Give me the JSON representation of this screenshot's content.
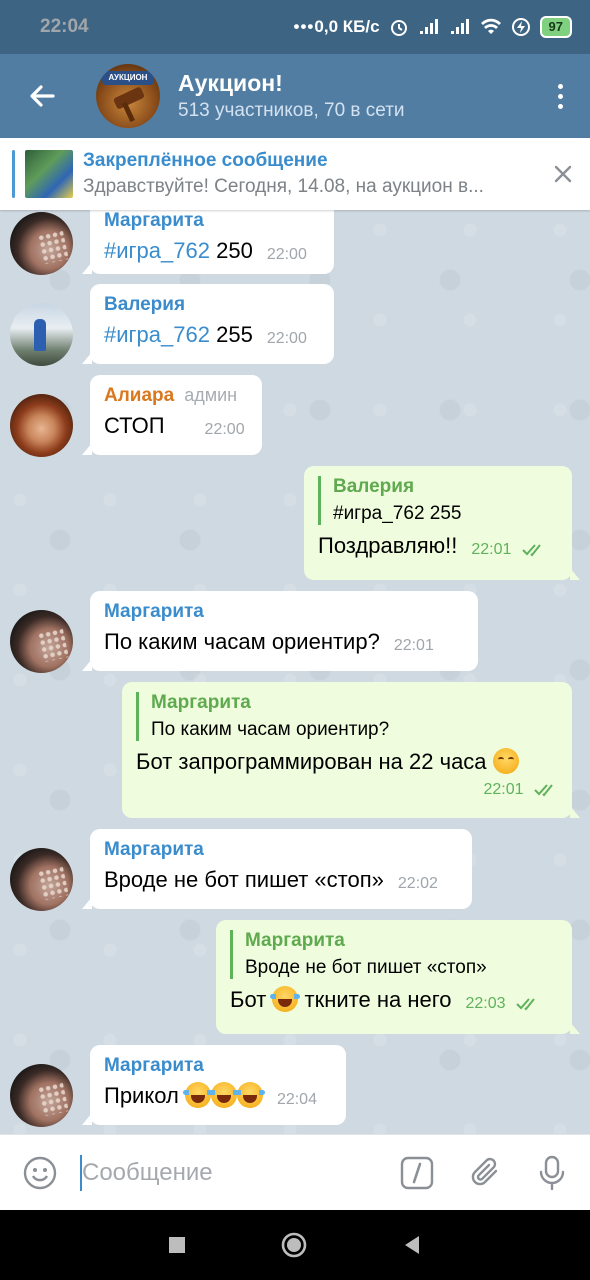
{
  "status_bar": {
    "time": "22:04",
    "network_speed": "0,0 КБ/с",
    "battery": "97",
    "icons": [
      "dots-icon",
      "alarm-icon",
      "signal-icon",
      "signal-icon",
      "wifi-icon",
      "charging-icon"
    ]
  },
  "header": {
    "title": "Аукцион!",
    "subtitle": "513 участников, 70 в сети",
    "avatar_label": "АУКЦИОН"
  },
  "pinned": {
    "title": "Закреплённое сообщение",
    "text": "Здравствуйте! Сегодня, 14.08, на аукцион в..."
  },
  "messages": [
    {
      "sender": "Маргарита",
      "hashtag": "#игра_762",
      "text": "250",
      "time": "22:00"
    },
    {
      "sender": "Валерия",
      "hashtag": "#игра_762",
      "text": "255",
      "time": "22:00"
    },
    {
      "sender": "Алиара",
      "role": "админ",
      "text": "СТОП",
      "time": "22:00"
    },
    {
      "reply_name": "Валерия",
      "reply_text": "#игра_762 255",
      "text": "Поздравляю!!",
      "time": "22:01"
    },
    {
      "sender": "Маргарита",
      "text": "По каким часам ориентир?",
      "time": "22:01"
    },
    {
      "reply_name": "Маргарита",
      "reply_text": "По каким часам ориентир?",
      "text": "Бот запрограммирован на 22 часа",
      "time": "22:01"
    },
    {
      "sender": "Маргарита",
      "text": "Вроде не бот пишет «стоп»",
      "time": "22:02"
    },
    {
      "reply_name": "Маргарита",
      "reply_text": "Вроде не бот пишет «стоп»",
      "text_before": "Бот",
      "text_after": "ткните на него",
      "time": "22:03"
    },
    {
      "sender": "Маргарита",
      "text": "Прикол",
      "time": "22:04"
    }
  ],
  "input": {
    "placeholder": "Сообщение"
  },
  "colors": {
    "header": "#527da3",
    "status_bar": "#3d6482",
    "link": "#3a8ccc",
    "outgoing_bubble": "#effdde",
    "admin_name": "#d9781e"
  }
}
